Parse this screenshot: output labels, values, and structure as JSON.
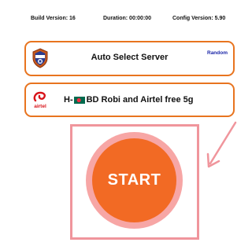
{
  "status": {
    "build": "Build Version: 16",
    "duration": "Duration: 00:00:00",
    "config": "Config Version: 5.90"
  },
  "server": {
    "label": "Auto Select Server",
    "random": "Random",
    "icon": "shield-badge-icon"
  },
  "network": {
    "logo_text": "airtel",
    "prefix": "H-",
    "name": "BD Robi and Airtel free 5g",
    "flag": "bangladesh-flag-icon"
  },
  "start": {
    "label": "START"
  },
  "colors": {
    "accent_orange": "#e8741f",
    "start_button": "#f26a24",
    "start_halo": "#f7a6a5",
    "highlight": "#f0959c",
    "random_link": "#1a25a8",
    "airtel_red": "#d8141a"
  }
}
